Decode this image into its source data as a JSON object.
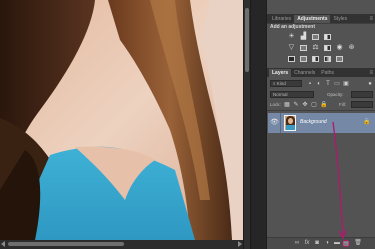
{
  "adjustments_panel": {
    "tabs": [
      {
        "label": "Libraries",
        "active": false
      },
      {
        "label": "Adjustments",
        "active": true
      },
      {
        "label": "Styles",
        "active": false
      }
    ],
    "menu_icon": "panel-menu-icon",
    "title": "Add an adjustment",
    "row1_icons": [
      "brightness-contrast-icon",
      "levels-icon",
      "curves-icon",
      "exposure-icon"
    ],
    "row2_icons": [
      "vibrance-icon",
      "hue-saturation-icon",
      "color-balance-icon",
      "black-white-icon",
      "photo-filter-icon",
      "channel-mixer-icon"
    ],
    "row3_icons": [
      "invert-icon",
      "posterize-icon",
      "threshold-icon",
      "selective-color-icon",
      "gradient-map-icon"
    ]
  },
  "layers_panel": {
    "tabs": [
      {
        "label": "Layers",
        "active": true
      },
      {
        "label": "Channels",
        "active": false
      },
      {
        "label": "Paths",
        "active": false
      }
    ],
    "filter_kind": "Kind",
    "blend_mode": "Normal",
    "opacity_label": "Opacity:",
    "lock_label": "Lock:",
    "fill_label": "Fill:",
    "layers": [
      {
        "name": "Background",
        "visible": true,
        "locked": true,
        "selected": true
      }
    ],
    "footer_icons": [
      "link-layers-icon",
      "fx-icon",
      "add-mask-icon",
      "adjustment-layer-icon",
      "group-icon",
      "new-layer-icon",
      "trash-icon"
    ]
  },
  "colors": {
    "panel_bg": "#535353",
    "tab_bar": "#323232",
    "selected_layer": "#7589a6",
    "annotation": "#b3176e"
  }
}
